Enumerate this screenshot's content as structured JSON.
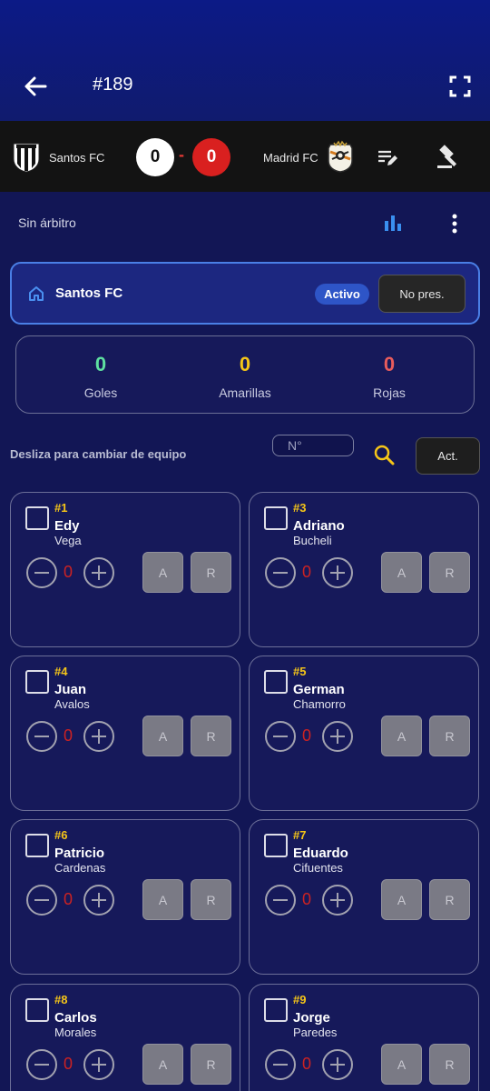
{
  "header": {
    "match_title": "#189",
    "back_icon": "arrow-left-icon",
    "fullscreen_icon": "fullscreen-icon"
  },
  "scoreboard": {
    "home_team": "Santos FC",
    "away_team": "Madrid FC",
    "home_score": "0",
    "separator": "-",
    "away_score": "0",
    "edit_icon": "edit-list-icon",
    "gavel_icon": "gavel-icon"
  },
  "toolbar": {
    "referee_text": "Sin árbitro",
    "chart_icon": "bar-chart-icon",
    "more_icon": "more-vertical-icon"
  },
  "team_panel": {
    "team_name": "Santos FC",
    "status": "Activo",
    "no_present_label": "No pres."
  },
  "stats": {
    "goals_value": "0",
    "goals_label": "Goles",
    "yellow_value": "0",
    "yellow_label": "Amarillas",
    "red_value": "0",
    "red_label": "Rojas"
  },
  "filter": {
    "hint": "Desliza para cambiar de equipo",
    "number_placeholder": "N°",
    "act_label": "Act."
  },
  "card_labels": {
    "yellow": "A",
    "red": "R"
  },
  "players": [
    {
      "number": "#1",
      "first": "Edy",
      "last": "Vega",
      "goals": "0"
    },
    {
      "number": "#3",
      "first": "Adriano",
      "last": "Bucheli",
      "goals": "0"
    },
    {
      "number": "#4",
      "first": "Juan",
      "last": "Avalos",
      "goals": "0"
    },
    {
      "number": "#5",
      "first": "German",
      "last": "Chamorro",
      "goals": "0"
    },
    {
      "number": "#6",
      "first": "Patricio",
      "last": "Cardenas",
      "goals": "0"
    },
    {
      "number": "#7",
      "first": "Eduardo",
      "last": "Cifuentes",
      "goals": "0"
    },
    {
      "number": "#8",
      "first": "Carlos",
      "last": "Morales",
      "goals": "0"
    },
    {
      "number": "#9",
      "first": "Jorge",
      "last": "Paredes",
      "goals": "0"
    }
  ],
  "colors": {
    "background": "#121655",
    "accent_blue": "#4a7fe6",
    "goals": "#5ee0a0",
    "yellow": "#f5c518",
    "red": "#e85c5c"
  }
}
